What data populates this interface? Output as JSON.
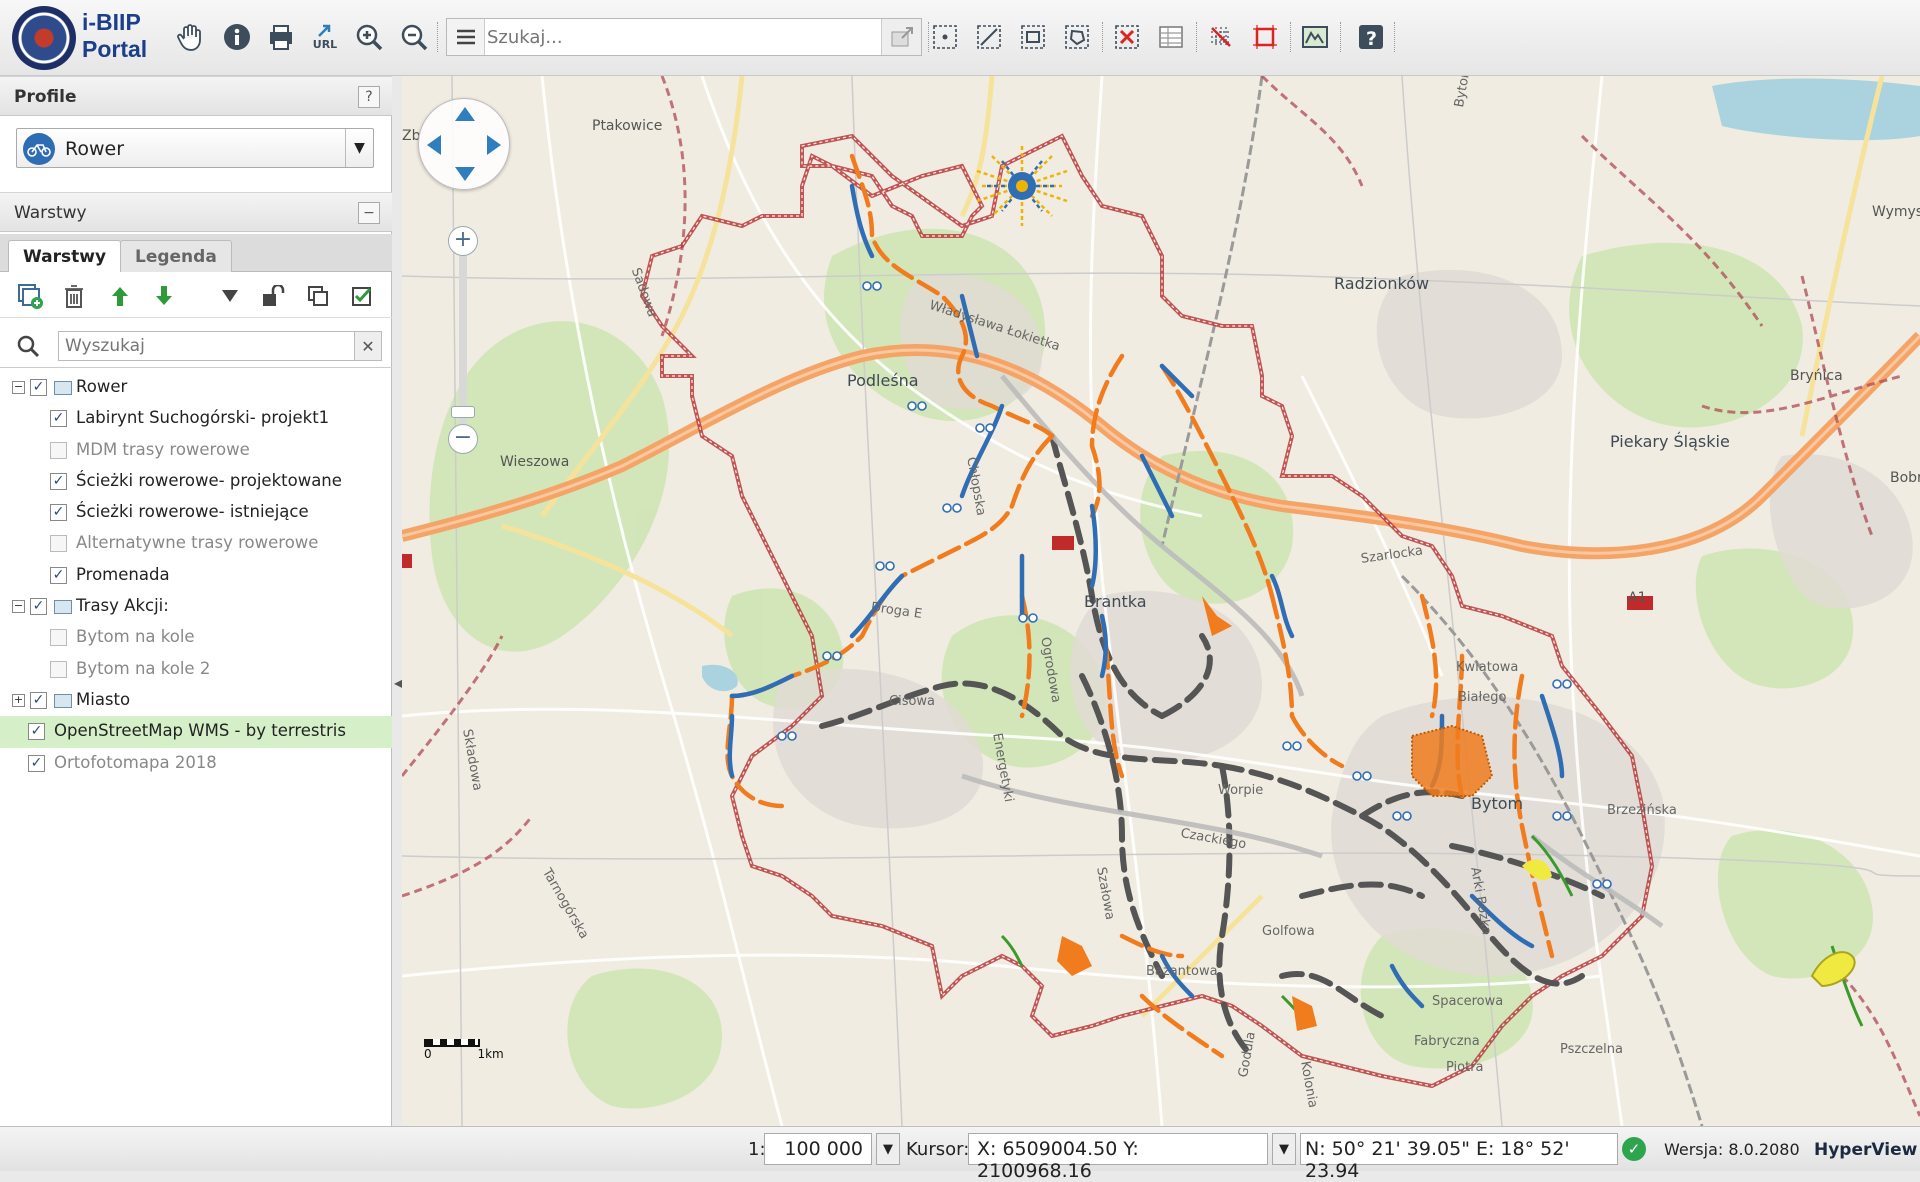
{
  "app": {
    "title_line1": "i-BIIP",
    "title_line2": "Portal"
  },
  "toolbar": {
    "tools": [
      "pan-hand-icon",
      "info-icon",
      "print-icon",
      "url-link-icon",
      "zoom-in-icon",
      "zoom-out-icon"
    ],
    "url_label": "URL",
    "search_placeholder": "Szukaj...",
    "select_tools": [
      "select-point-icon",
      "select-line-icon",
      "select-rectangle-icon",
      "select-polygon-icon",
      "clear-selection-icon",
      "attribute-table-icon",
      "remove-selection-icon",
      "cancel-select-icon",
      "map-legend-icon",
      "help-icon"
    ]
  },
  "profile": {
    "header": "Profile",
    "help": "?",
    "selected": "Rower"
  },
  "layers": {
    "header": "Warstwy",
    "collapse": "−",
    "tabs": [
      "Warstwy",
      "Legenda"
    ],
    "filter_placeholder": "Wyszukaj",
    "clear": "✕",
    "tree": [
      {
        "label": "Rower",
        "checked": true,
        "level": 0,
        "expander": "−",
        "folder": true
      },
      {
        "label": "Labirynt Suchogórski- projekt1",
        "checked": true,
        "level": 1
      },
      {
        "label": "MDM trasy rowerowe",
        "checked": false,
        "level": 1
      },
      {
        "label": "Ścieżki rowerowe- projektowane",
        "checked": true,
        "level": 1
      },
      {
        "label": "Ścieżki rowerowe- istniejące",
        "checked": true,
        "level": 1
      },
      {
        "label": "Alternatywne trasy rowerowe",
        "checked": false,
        "level": 1
      },
      {
        "label": "Promenada",
        "checked": true,
        "level": 1
      },
      {
        "label": "Trasy Akcji:",
        "checked": true,
        "level": 0,
        "expander": "−",
        "folder": true
      },
      {
        "label": "Bytom na kole",
        "checked": false,
        "level": 1
      },
      {
        "label": "Bytom na kole 2",
        "checked": false,
        "level": 1
      },
      {
        "label": "Miasto",
        "checked": true,
        "level": 0,
        "expander": "+",
        "folder": true
      },
      {
        "label": "OpenStreetMap WMS - by terrestris",
        "checked": true,
        "level": -1,
        "selected": true
      },
      {
        "label": "Ortofotomapa 2018",
        "checked": true,
        "level": -1,
        "muted": true
      }
    ]
  },
  "map": {
    "places": [
      {
        "name": "Ptakowice",
        "cls": "place"
      },
      {
        "name": "Zb",
        "cls": "place"
      },
      {
        "name": "Radzionków",
        "cls": "place big"
      },
      {
        "name": "Wymys",
        "cls": "place"
      },
      {
        "name": "Bytom",
        "cls": "place street"
      },
      {
        "name": "Podleśna",
        "cls": "place big"
      },
      {
        "name": "Władysława Łokietka",
        "cls": "place street"
      },
      {
        "name": "Sadowa",
        "cls": "place street"
      },
      {
        "name": "Wieszowa",
        "cls": "place"
      },
      {
        "name": "Bryńica",
        "cls": "place"
      },
      {
        "name": "Piekary Śląskie",
        "cls": "place big"
      },
      {
        "name": "Bobr",
        "cls": "place"
      },
      {
        "name": "Szarlocka",
        "cls": "place street"
      },
      {
        "name": "A1",
        "cls": "place"
      },
      {
        "name": "Brantka",
        "cls": "place big"
      },
      {
        "name": "Droga E",
        "cls": "place street"
      },
      {
        "name": "Chłopska",
        "cls": "place street"
      },
      {
        "name": "Kwiatowa",
        "cls": "place street"
      },
      {
        "name": "Białego",
        "cls": "place street"
      },
      {
        "name": "Cisowa",
        "cls": "place street"
      },
      {
        "name": "Energetyki",
        "cls": "place street"
      },
      {
        "name": "Ogrodowa",
        "cls": "place street"
      },
      {
        "name": "Brzezińska",
        "cls": "place street"
      },
      {
        "name": "Bytom",
        "cls": "place big"
      },
      {
        "name": "Worpie",
        "cls": "place street"
      },
      {
        "name": "Czackiego",
        "cls": "place street"
      },
      {
        "name": "Składowa",
        "cls": "place street"
      },
      {
        "name": "Tarnogórska",
        "cls": "place street"
      },
      {
        "name": "Szałowa",
        "cls": "place street"
      },
      {
        "name": "Golfowa",
        "cls": "place street"
      },
      {
        "name": "Arki Bożka",
        "cls": "place street"
      },
      {
        "name": "Bażantowa",
        "cls": "place street"
      },
      {
        "name": "Spacerowa",
        "cls": "place street"
      },
      {
        "name": "Fabryczna",
        "cls": "place street"
      },
      {
        "name": "Pszczelna",
        "cls": "place street"
      },
      {
        "name": "Piotra",
        "cls": "place street"
      },
      {
        "name": "Kolonia",
        "cls": "place street"
      },
      {
        "name": "Godula",
        "cls": "place street"
      }
    ],
    "scale_zero": "0",
    "scale_km": "1km"
  },
  "status": {
    "scale_prefix": "1:",
    "scale_value": "100 000",
    "cursor_label": "Kursor:",
    "xy": "X: 6509004.50  Y: 2100968.16",
    "geo": "N: 50° 21' 39.05\" E: 18° 52' 23.94",
    "version": "Wersja: 8.0.2080",
    "brand": "HyperView"
  },
  "colors": {
    "existing": "#2f6db5",
    "planned": "#f07c1e",
    "promenade": "#555555",
    "boundary": "#b83b3b",
    "highway": "#f4a466"
  }
}
